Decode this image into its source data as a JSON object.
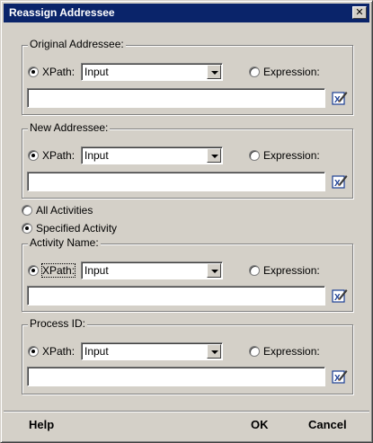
{
  "dialog": {
    "title": "Reassign Addressee",
    "close_glyph": "✕"
  },
  "groups": [
    {
      "legend": "Original Addressee:",
      "xpath_label": "XPath:",
      "xpath_checked": true,
      "combo_value": "Input",
      "expression_label": "Expression:",
      "expression_checked": false,
      "field_value": ""
    },
    {
      "legend": "New Addressee:",
      "xpath_label": "XPath:",
      "xpath_checked": true,
      "combo_value": "Input",
      "expression_label": "Expression:",
      "expression_checked": false,
      "field_value": ""
    },
    {
      "legend": "Activity Name:",
      "xpath_label": "XPath:",
      "xpath_checked": true,
      "combo_value": "Input",
      "expression_label": "Expression:",
      "expression_checked": false,
      "field_value": ""
    },
    {
      "legend": "Process ID:",
      "xpath_label": "XPath:",
      "xpath_checked": true,
      "combo_value": "Input",
      "expression_label": "Expression:",
      "expression_checked": false,
      "field_value": ""
    }
  ],
  "scope": {
    "all_activities_label": "All Activities",
    "all_activities_checked": false,
    "specified_activity_label": "Specified Activity",
    "specified_activity_checked": true
  },
  "footer": {
    "help_label": "Help",
    "ok_label": "OK",
    "cancel_label": "Cancel"
  },
  "icons": {
    "edit_expression": "edit-expression-icon"
  },
  "colors": {
    "face": "#d4d0c8",
    "titlebar": "#0a246a"
  }
}
